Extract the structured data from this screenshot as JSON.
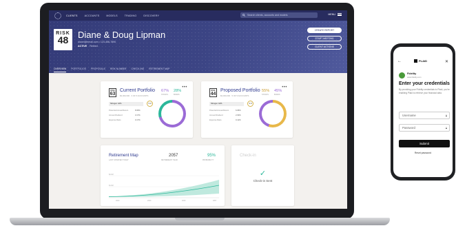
{
  "nav": {
    "items": [
      "CLIENTS",
      "ACCOUNTS",
      "MODELS",
      "TRADING",
      "DISCOVERY"
    ],
    "search_placeholder": "Search clients, accounts and models",
    "menu_label": "MENU"
  },
  "client": {
    "risk_label": "RISK",
    "risk_score": "48",
    "name": "Diane & Doug Lipman",
    "contact": "dianel@email.com  •  123-456-7890",
    "status": "ACTIVE",
    "status_note": "Retired"
  },
  "header_buttons": {
    "create_report": "CREATE REPORT",
    "start_meeting": "START MEETING",
    "client_actions": "CLIENT ACTIONS"
  },
  "subtabs": [
    "OVERVIEW",
    "PORTFOLIOS",
    "PROPOSALS",
    "RISK NUMBER",
    "CHECK-INS",
    "RETIREMENT MAP"
  ],
  "current_portfolio": {
    "risk_label": "RISK",
    "risk_score": "63",
    "title": "Current Portfolio",
    "subtitle": "$3,000,000 · 3 OF 5 ACCOUNTS",
    "gpa_label": "Nitrogen GPA",
    "gpa_value": "3.0",
    "rows": [
      {
        "label": "Potential Annual Return",
        "value": "8.95%"
      },
      {
        "label": "Annual Dividend",
        "value": "3.17%"
      },
      {
        "label": "Expense Ratio",
        "value": "0.17%"
      }
    ],
    "stocks_pct": "67%",
    "stocks_label": "STOCKS",
    "bonds_pct": "28%",
    "bonds_label": "BONDS",
    "stocks_color": "#9b6bd6",
    "bonds_color": "#2bb79a"
  },
  "proposed_portfolio": {
    "risk_label": "RISK",
    "risk_score": "44",
    "title": "Proposed Portfolio",
    "subtitle": "$3,000,000 · 5 OF 5 ACCOUNTS",
    "gpa_label": "Nitrogen GPA",
    "gpa_value": "3.0",
    "rows": [
      {
        "label": "Potential Annual Return",
        "value": "6.95%"
      },
      {
        "label": "Annual Dividend",
        "value": "2.63%"
      },
      {
        "label": "Expense Ratio",
        "value": "0.12%"
      }
    ],
    "stocks_pct": "55%",
    "stocks_label": "STOCKS",
    "bonds_pct": "45%",
    "bonds_label": "BONDS",
    "stocks_color": "#e8b84a",
    "bonds_color": "#9b6bd6"
  },
  "retirement_map": {
    "title": "Retirement Map",
    "subtitle": "LAST UPDATED TODAY",
    "year": "2057",
    "year_label": "RETIREMENT YEAR",
    "probability": "95%",
    "probability_label": "PROBABILITY",
    "y_ticks": [
      "$2.0M",
      "$1.0M"
    ],
    "x_ticks": [
      "2020",
      "2030",
      "2040",
      "2057"
    ],
    "accent_color": "#2bb79a"
  },
  "checkin": {
    "title": "Check-in",
    "status": "Check-in Sent"
  },
  "phone": {
    "brand": "PLAID",
    "bank_name": "Fidelity",
    "bank_url": "www.fidelity.com",
    "heading": "Enter your credentials",
    "body": "By providing your Fidelity credentials to Plaid, you're enabling Plaid to retrieve your financial data.",
    "username_placeholder": "Username",
    "password_placeholder": "Password",
    "submit_label": "Submit",
    "reset_label": "Reset password"
  }
}
